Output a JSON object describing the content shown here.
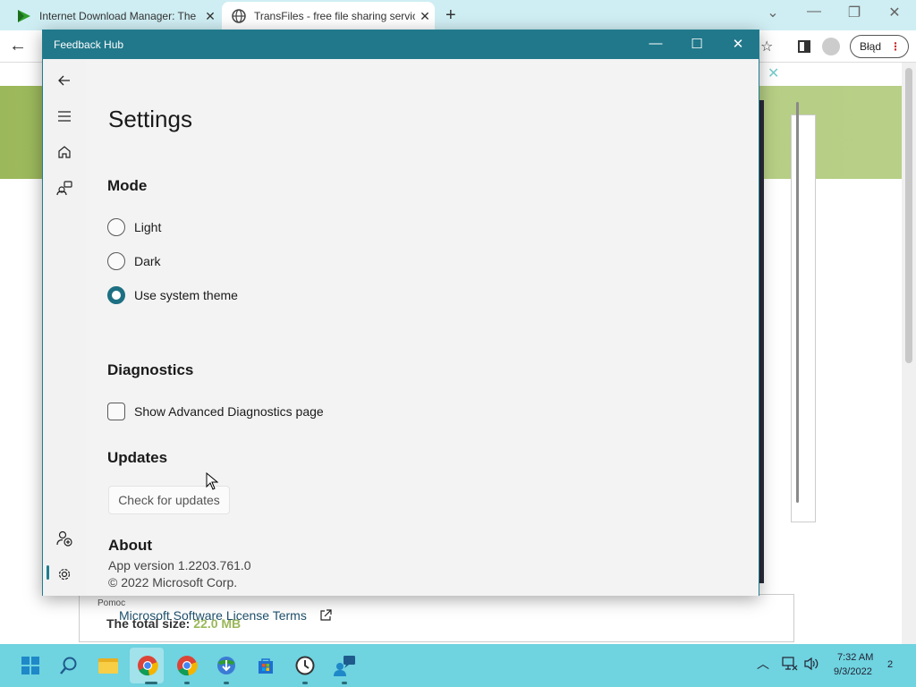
{
  "browser": {
    "tabs": [
      {
        "title": "Internet Download Manager: The",
        "icon": "idm-icon"
      },
      {
        "title": "TransFiles - free file sharing servic",
        "icon": "globe-icon"
      }
    ],
    "new_tab": "+",
    "profile_label": "Błąd",
    "page": {
      "help_link": "Pomoc",
      "total_size_label": "The total size:",
      "total_size_value": "22.0 MB"
    }
  },
  "feedback_hub": {
    "window_title": "Feedback Hub",
    "nav": {
      "items": [
        "back-arrow-icon",
        "hamburger-menu-icon",
        "home-icon",
        "feedback-icon",
        "add-user-icon",
        "settings-gear-icon"
      ],
      "selected": "settings-gear-icon"
    },
    "settings": {
      "title": "Settings",
      "mode": {
        "heading": "Mode",
        "options": [
          "Light",
          "Dark",
          "Use system theme"
        ],
        "selected": "Use system theme"
      },
      "diagnostics": {
        "heading": "Diagnostics",
        "checkbox_label": "Show Advanced Diagnostics page",
        "checked": false
      },
      "updates": {
        "heading": "Updates",
        "button_label": "Check for updates"
      },
      "about": {
        "heading": "About",
        "app_version": "App version 1.2203.761.0",
        "copyright": "© 2022 Microsoft Corp.",
        "license_link": "Microsoft Software License Terms"
      }
    }
  },
  "taskbar": {
    "apps": [
      "windows-start-icon",
      "search-icon",
      "file-explorer-icon",
      "chrome-icon",
      "chrome-icon",
      "idm-icon",
      "microsoft-store-icon",
      "clock-app-icon",
      "feedback-hub-icon"
    ],
    "time": "7:32 AM",
    "date": "9/3/2022",
    "notification_count": "2"
  },
  "colors": {
    "accent": "#1d6f82",
    "titlebar": "#21788a",
    "taskbar": "#6fd3e0"
  }
}
